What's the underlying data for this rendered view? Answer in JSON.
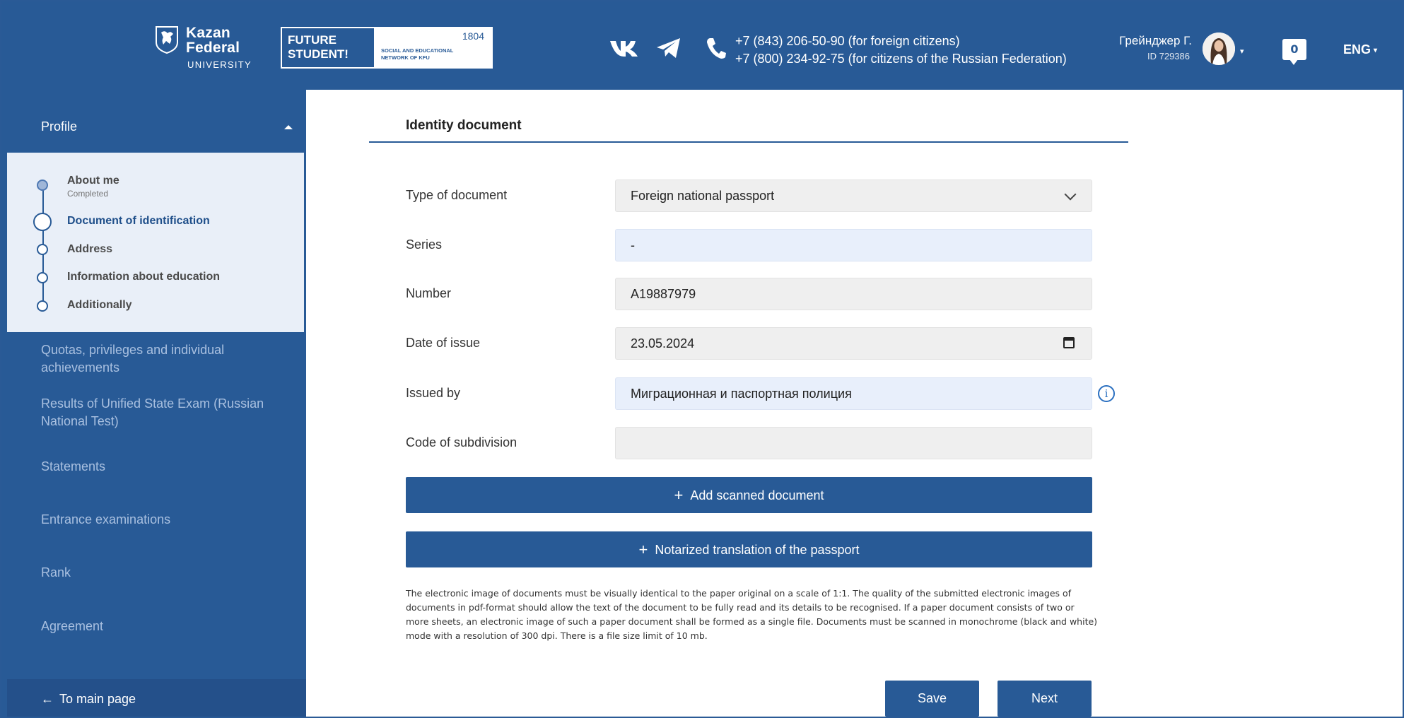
{
  "header": {
    "university": {
      "line1": "Kazan",
      "line2": "Federal",
      "line3": "UNIVERSITY"
    },
    "future_student": {
      "title_line1": "FUTURE",
      "title_line2": "STUDENT!",
      "year": "1804",
      "subtitle_line1": "SOCIAL AND EDUCATIONAL",
      "subtitle_line2": "NETWORK OF KFU"
    },
    "phones": {
      "line1": "+7 (843) 206-50-90 (for foreign citizens)",
      "line2": "+7 (800) 234-92-75 (for citizens of the Russian Federation)"
    },
    "user": {
      "name": "Грейнджер Г.",
      "id": "ID 729386"
    },
    "notifications_count": "0",
    "language": "ENG"
  },
  "sidebar": {
    "profile_label": "Profile",
    "steps": [
      {
        "label": "About me",
        "status": "Completed"
      },
      {
        "label": "Document of identification"
      },
      {
        "label": "Address"
      },
      {
        "label": "Information about education"
      },
      {
        "label": "Additionally"
      }
    ],
    "nav": [
      "Quotas, privileges and individual achievements",
      "Results of Unified State Exam (Russian National Test)",
      "Statements",
      "Entrance examinations",
      "Rank",
      "Agreement"
    ],
    "to_main": "To main page"
  },
  "form": {
    "title": "Identity document",
    "type_label": "Type of document",
    "type_value": "Foreign national passport",
    "series_label": "Series",
    "series_value": "-",
    "number_label": "Number",
    "number_value": "A19887979",
    "date_label": "Date of issue",
    "date_value": "23.05.2024",
    "issued_label": "Issued by",
    "issued_value": "Миграционная и паспортная полиция",
    "code_label": "Code of subdivision",
    "code_value": "",
    "add_scan": "Add scanned document",
    "notarized": "Notarized translation of the passport",
    "notice": "The electronic image of documents must be visually identical to the paper original on a scale of 1:1. The quality of the submitted electronic images of documents in pdf-format should allow the text of the document to be fully read and its details to be recognised. If a paper document consists of two or more sheets, an electronic image of such a paper document shall be formed as a single file. Documents must be scanned in monochrome (black and white) mode with a resolution of 300 dpi. There is a file size limit of 10 mb.",
    "save": "Save",
    "next": "Next"
  },
  "colors": {
    "brand": "#285a96",
    "steps_bg": "#e9eff8",
    "field_grey": "#efefef",
    "field_blue": "#e8effb"
  }
}
